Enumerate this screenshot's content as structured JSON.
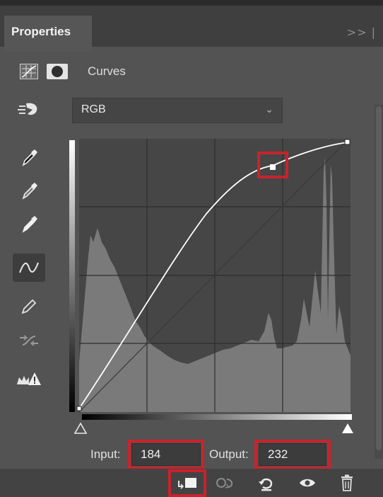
{
  "panel": {
    "tab_label": "Properties",
    "collapse_glyph": ">> |",
    "adjustment_title": "Curves"
  },
  "channel": {
    "selected": "RGB"
  },
  "curve": {
    "input_label": "Input:",
    "input_value": "184",
    "output_label": "Output:",
    "output_value": "232"
  },
  "tools": [
    {
      "icon": "on-image-adjust-icon"
    },
    {
      "icon": "black-point-eyedropper-icon"
    },
    {
      "icon": "gray-point-eyedropper-icon"
    },
    {
      "icon": "white-point-eyedropper-icon"
    },
    {
      "icon": "edit-points-curve-icon"
    },
    {
      "icon": "pencil-draw-icon"
    },
    {
      "icon": "smooth-curve-icon"
    },
    {
      "icon": "clipping-warning-icon"
    }
  ],
  "bottom_icons": [
    "clip-to-layer-icon",
    "view-previous-state-icon",
    "reset-icon",
    "visibility-icon",
    "delete-icon"
  ],
  "colors": {
    "highlight": "#c8232c",
    "panel_bg": "#535353"
  }
}
